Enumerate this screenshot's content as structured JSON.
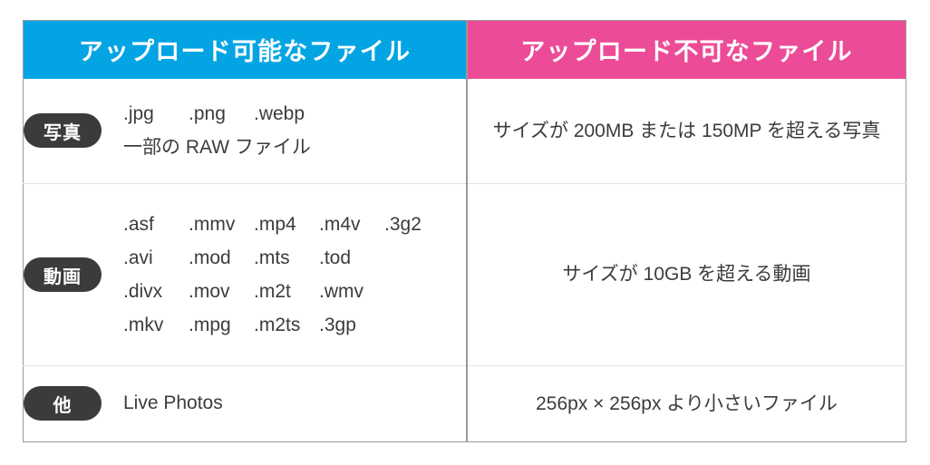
{
  "table": {
    "headers": {
      "allowed": "アップロード可能なファイル",
      "blocked": "アップロード不可なファイル"
    },
    "colors": {
      "allowed_header_bg": "#03a4e4",
      "blocked_header_bg": "#ec4c97",
      "badge_bg": "#3b3b39",
      "text": "#3c3c3c",
      "outer_border": "#9a9a9a",
      "row_divider": "#e3e3e3"
    },
    "rows": [
      {
        "badge": "写真",
        "allowed_lines": [
          [
            ".jpg",
            ".png",
            ".webp"
          ]
        ],
        "allowed_note": "一部の RAW ファイル",
        "blocked": "サイズが 200MB または 150MP を超える写真"
      },
      {
        "badge": "動画",
        "allowed_lines": [
          [
            ".asf",
            ".mmv",
            ".mp4",
            ".m4v",
            ".3g2"
          ],
          [
            ".avi",
            ".mod",
            ".mts",
            ".tod"
          ],
          [
            ".divx",
            ".mov",
            ".m2t",
            ".wmv"
          ],
          [
            ".mkv",
            ".mpg",
            ".m2ts",
            ".3gp"
          ]
        ],
        "allowed_note": "",
        "blocked": "サイズが 10GB を超える動画"
      },
      {
        "badge": "他",
        "allowed_lines": [],
        "allowed_note": "Live Photos",
        "blocked": "256px × 256px より小さいファイル"
      }
    ]
  }
}
